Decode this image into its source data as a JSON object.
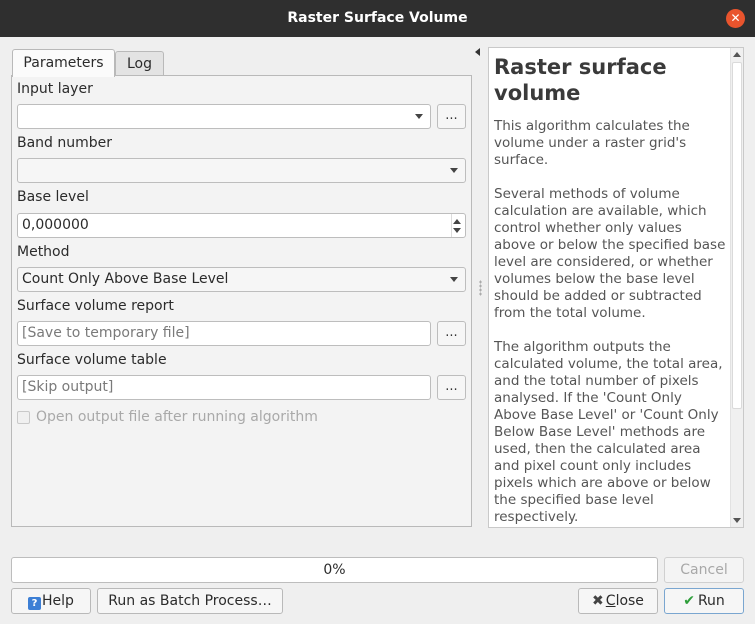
{
  "window": {
    "title": "Raster Surface Volume"
  },
  "tabs": [
    {
      "label": "Parameters",
      "active": true
    },
    {
      "label": "Log",
      "active": false
    }
  ],
  "params": {
    "input_layer": {
      "label": "Input layer",
      "value": "",
      "browse_label": "..."
    },
    "band_number": {
      "label": "Band number",
      "value": ""
    },
    "base_level": {
      "label": "Base level",
      "value": "0,000000"
    },
    "method": {
      "label": "Method",
      "value": "Count Only Above Base Level"
    },
    "report": {
      "label": "Surface volume report",
      "placeholder": "[Save to temporary file]",
      "browse_label": "..."
    },
    "table": {
      "label": "Surface volume table",
      "placeholder": "[Skip output]",
      "browse_label": "..."
    },
    "open_after": {
      "label": "Open output file after running algorithm",
      "checked": false,
      "enabled": false
    }
  },
  "help": {
    "title": "Raster surface volume",
    "paragraphs": [
      "This algorithm calculates the volume under a raster grid's surface.",
      "Several methods of volume calculation are available, which control whether only values above or below the specified base level are considered, or whether volumes below the base level should be added or subtracted from the total volume.",
      "The algorithm outputs the calculated volume, the total area, and the total number of pixels analysed. If the 'Count Only Above Base Level' or 'Count Only Below Base Level' methods are used, then the calculated area and pixel count only includes pixels which are above or below the specified base level respectively."
    ]
  },
  "progress": {
    "text": "0%",
    "value": 0
  },
  "buttons": {
    "cancel": "Cancel",
    "help": "Help",
    "batch": "Run as Batch Process…",
    "close_prefix": "",
    "close_underlined": "C",
    "close_rest": "lose",
    "run": "Run"
  },
  "icons": {
    "close": "close-icon",
    "help": "help-icon",
    "close_button": "x-icon",
    "run": "check-icon"
  },
  "colors": {
    "titlebar": "#2f2f2f",
    "close_circle": "#e9542d",
    "progress_fill": "#88c0ec"
  }
}
